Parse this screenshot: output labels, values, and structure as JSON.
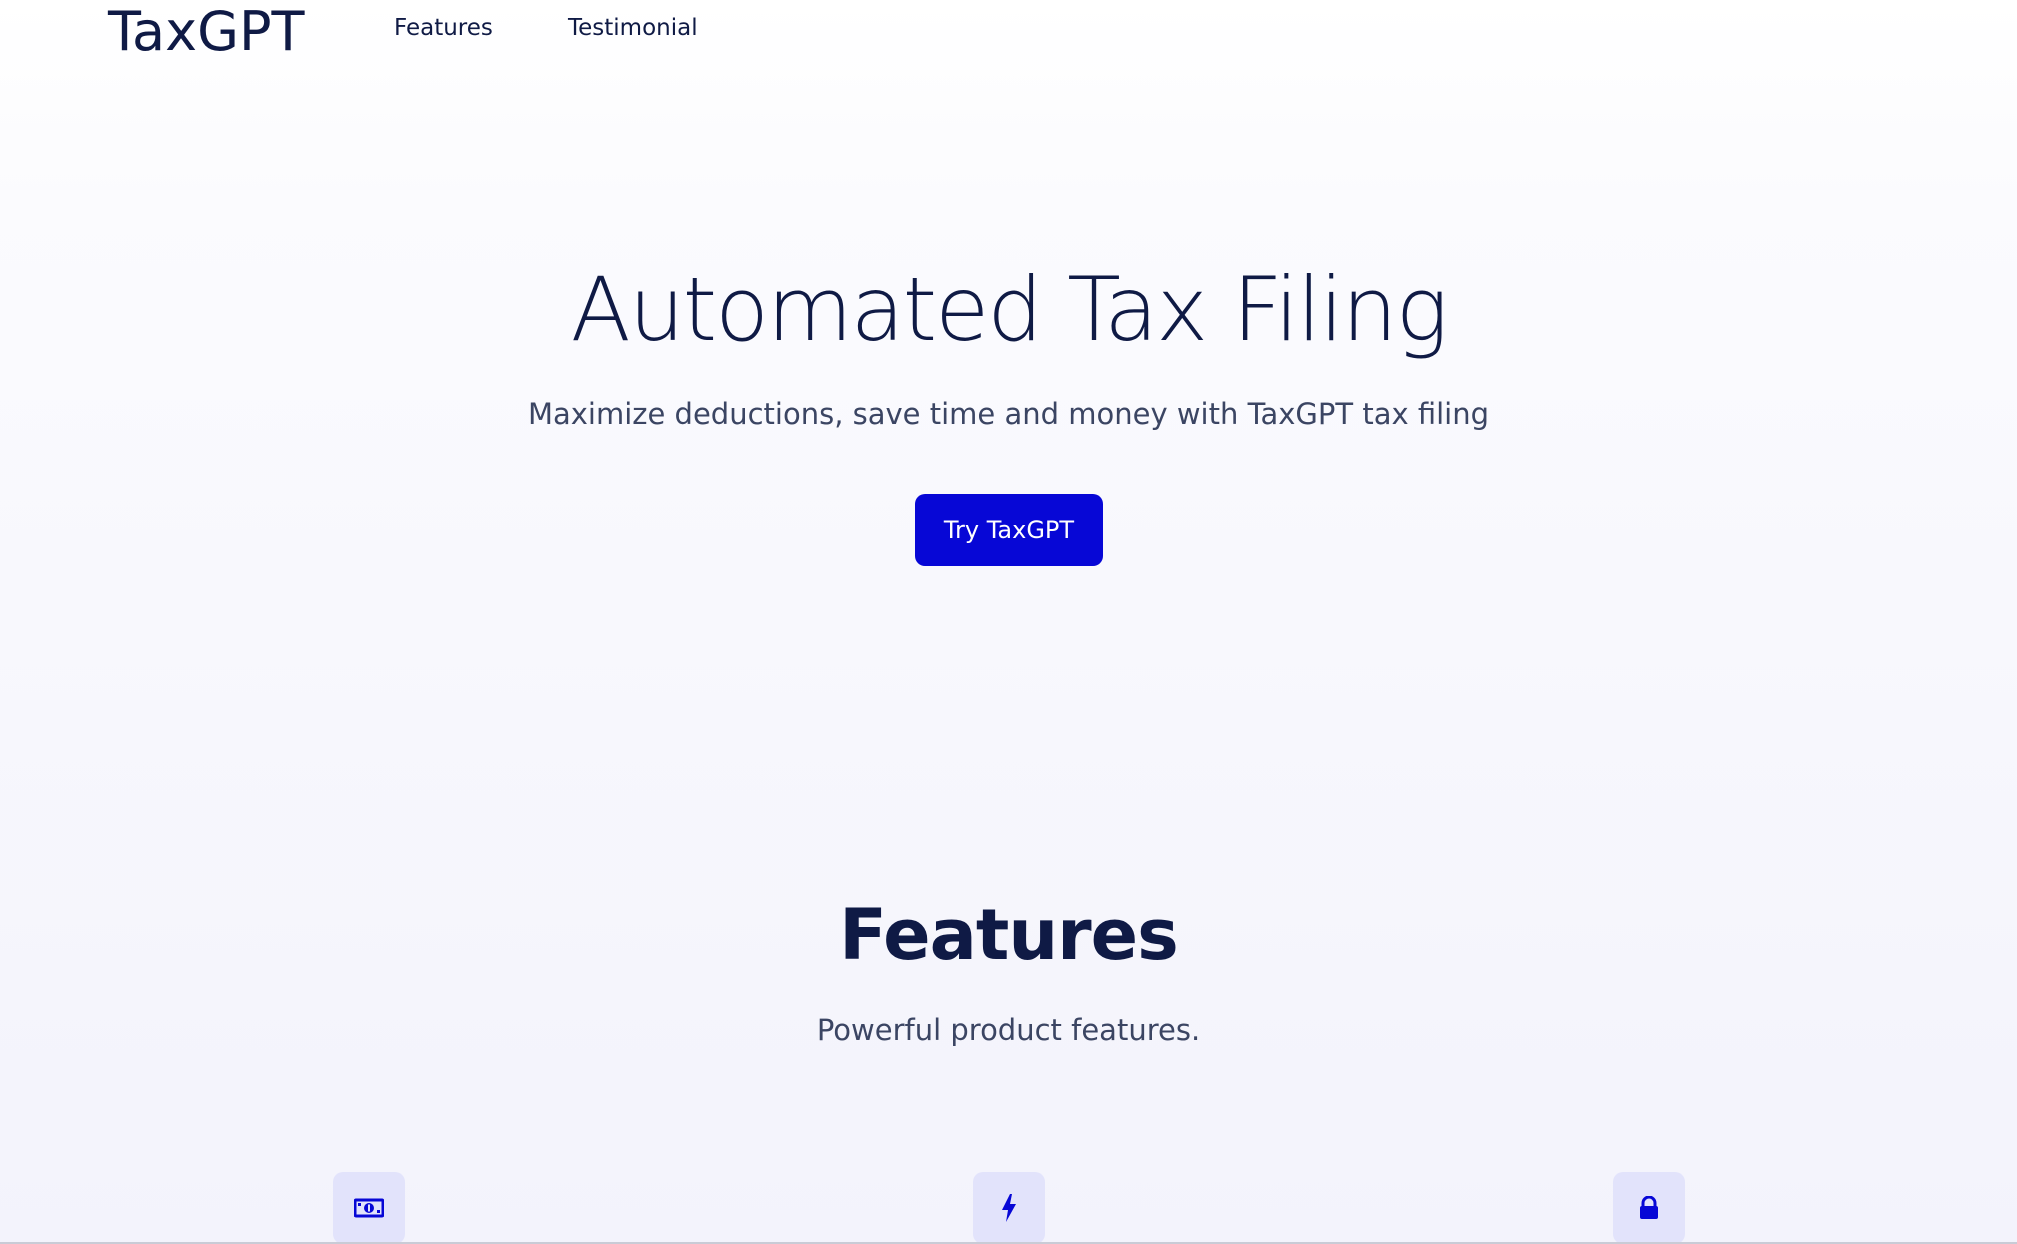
{
  "nav": {
    "brand": "TaxGPT",
    "links": [
      {
        "label": "Features"
      },
      {
        "label": "Testimonial"
      }
    ]
  },
  "hero": {
    "title": "Automated Tax Filing",
    "subtitle": "Maximize deductions, save time and money with TaxGPT tax filing",
    "cta_label": "Try TaxGPT"
  },
  "features": {
    "title": "Features",
    "subtitle": "Powerful product features.",
    "icons": [
      {
        "icon": "money-icon"
      },
      {
        "icon": "lightning-icon"
      },
      {
        "icon": "lock-icon"
      }
    ]
  },
  "colors": {
    "brand_text": "#0f1a45",
    "accent": "#0707d6",
    "icon_bg": "#e2e3fb",
    "muted_text": "#3b4563"
  }
}
